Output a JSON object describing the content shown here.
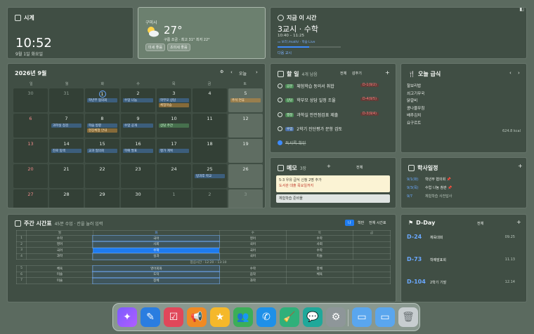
{
  "clock": {
    "title": "시계",
    "time": "10:52",
    "date": "9월 1일 화요일"
  },
  "weather": {
    "location": "구미시",
    "temp": "27°",
    "desc": "구름 조금 · 최고 31° 최저 22°",
    "chips": [
      "미세 좋음",
      "초미세 좋음"
    ]
  },
  "period": {
    "title": "지금 이 시간",
    "current": "3교시 · 수학",
    "time_range": "10:40 – 11:25",
    "link": "▭ 보러 /math/ · 학습 Live",
    "next": "다음 교시",
    "progress": 0.5
  },
  "calendar": {
    "title": "2026년 9월",
    "today_label": "오늘",
    "prev": "‹",
    "next": "›",
    "weekdays": [
      "일",
      "월",
      "화",
      "수",
      "목",
      "금",
      "토"
    ],
    "rows": [
      [
        "30",
        "31",
        "1",
        "2",
        "3",
        "4",
        "5"
      ],
      [
        "6",
        "7",
        "8",
        "9",
        "10",
        "11",
        "12"
      ],
      [
        "13",
        "14",
        "15",
        "16",
        "17",
        "18",
        "19"
      ],
      [
        "20",
        "21",
        "22",
        "23",
        "24",
        "25",
        "26"
      ],
      [
        "27",
        "28",
        "29",
        "30",
        "1",
        "2",
        "3"
      ]
    ],
    "events": {
      "e1": "학년부 협의회",
      "e2": "수업 나눔",
      "e3": "학부모 상담",
      "e4": "체험학습",
      "e5": "과학실 점검",
      "e6": "학습 방향",
      "e7": "현장체험 안내",
      "e8": "수업 공개",
      "e9": "상담 주간",
      "e10": "진로 탐색",
      "e11": "교과 협의회",
      "e12": "학예 발표",
      "e13": "평가 계획",
      "e14": "방과후 학교",
      "e15": "추석 연휴"
    }
  },
  "todo": {
    "title": "할 일",
    "count": "4개 남음",
    "filter_all": "전체",
    "filter_hide": "감추기",
    "items": [
      {
        "tag": "공문",
        "text": "체험학습 동의서 취합",
        "due": "D-1(9/2)"
      },
      {
        "tag": "상담",
        "text": "학부모 상담 일정 조율",
        "due": "D-4(9/5)"
      },
      {
        "tag": "행정",
        "text": "과학실 안전점검표 제출",
        "due": "D-3(9/4)"
      },
      {
        "tag": "수업",
        "text": "2학기 진단평가 문항 검토",
        "due": ""
      },
      {
        "tag": "",
        "text": "독서록 확인",
        "due": ""
      }
    ]
  },
  "meal": {
    "title": "오늘 급식",
    "items": [
      "찰보리밥",
      "쇠고기무국",
      "닭갈비",
      "콩나물무침",
      "배추김치",
      "요구르트"
    ],
    "kcal": "624.8 kcal",
    "prev": "‹",
    "next": "›"
  },
  "memo": {
    "title": "메모",
    "count": "3장",
    "add": "+",
    "all": "전체",
    "note1_line1": "5-3 우유 급식 신청 2명 추가",
    "note1_line2": "도서관 대출 목요일까지",
    "note2": "체험학습 준비물"
  },
  "schedule": {
    "title": "학사일정",
    "add": "+",
    "items": [
      {
        "date": "9/1(화)",
        "text": "학년부 협의회"
      },
      {
        "date": "9/3(목)",
        "text": "수업 나눔 참관"
      },
      {
        "date": "9/7",
        "text": "체험학습 사전답사"
      }
    ]
  },
  "timetable": {
    "title": "주간 시간표",
    "subtitle": "45분 수업 · 칸을 눌러 입력",
    "toggles": [
      "나",
      "학반",
      "전체 시간표"
    ],
    "days": [
      "월",
      "화",
      "수",
      "목",
      "금"
    ],
    "rows": [
      [
        "1",
        "수학",
        "국어",
        "영어",
        "수학",
        ""
      ],
      [
        "2",
        "영어",
        "사회",
        "국어",
        "사회",
        ""
      ],
      [
        "3",
        "국어",
        "수학",
        "국어",
        "수학",
        ""
      ],
      [
        "4",
        "과학",
        "실과",
        "국어",
        "미술",
        ""
      ]
    ],
    "lunch": "점심시간 · 12:20 – 13:10",
    "rows2": [
      [
        "5",
        "체육",
        "영어회화",
        "수학",
        "창체",
        ""
      ],
      [
        "6",
        "미술",
        "도덕",
        "음악",
        "체육",
        ""
      ],
      [
        "7",
        "미술",
        "창체",
        "과학",
        "",
        ""
      ]
    ]
  },
  "dday": {
    "title": "D-Day",
    "all": "전체",
    "items": [
      {
        "d": "D-24",
        "name": "체육대회",
        "date": "09.25"
      },
      {
        "d": "D-73",
        "name": "학예발표회",
        "date": "11.13"
      },
      {
        "d": "D-104",
        "name": "2학기 기말",
        "date": "12.14"
      }
    ]
  },
  "dock": [
    "sparkle-app",
    "pen-app",
    "clipboard-app",
    "megaphone-app",
    "star-app",
    "people-app",
    "phone-app",
    "broom-app",
    "chat-app",
    "settings-app",
    "folder-app",
    "folder2-app",
    "trash-app"
  ],
  "colors": {
    "accent": "#1e7bf0",
    "due": "#ff8080",
    "dday": "#6aa8ff"
  }
}
